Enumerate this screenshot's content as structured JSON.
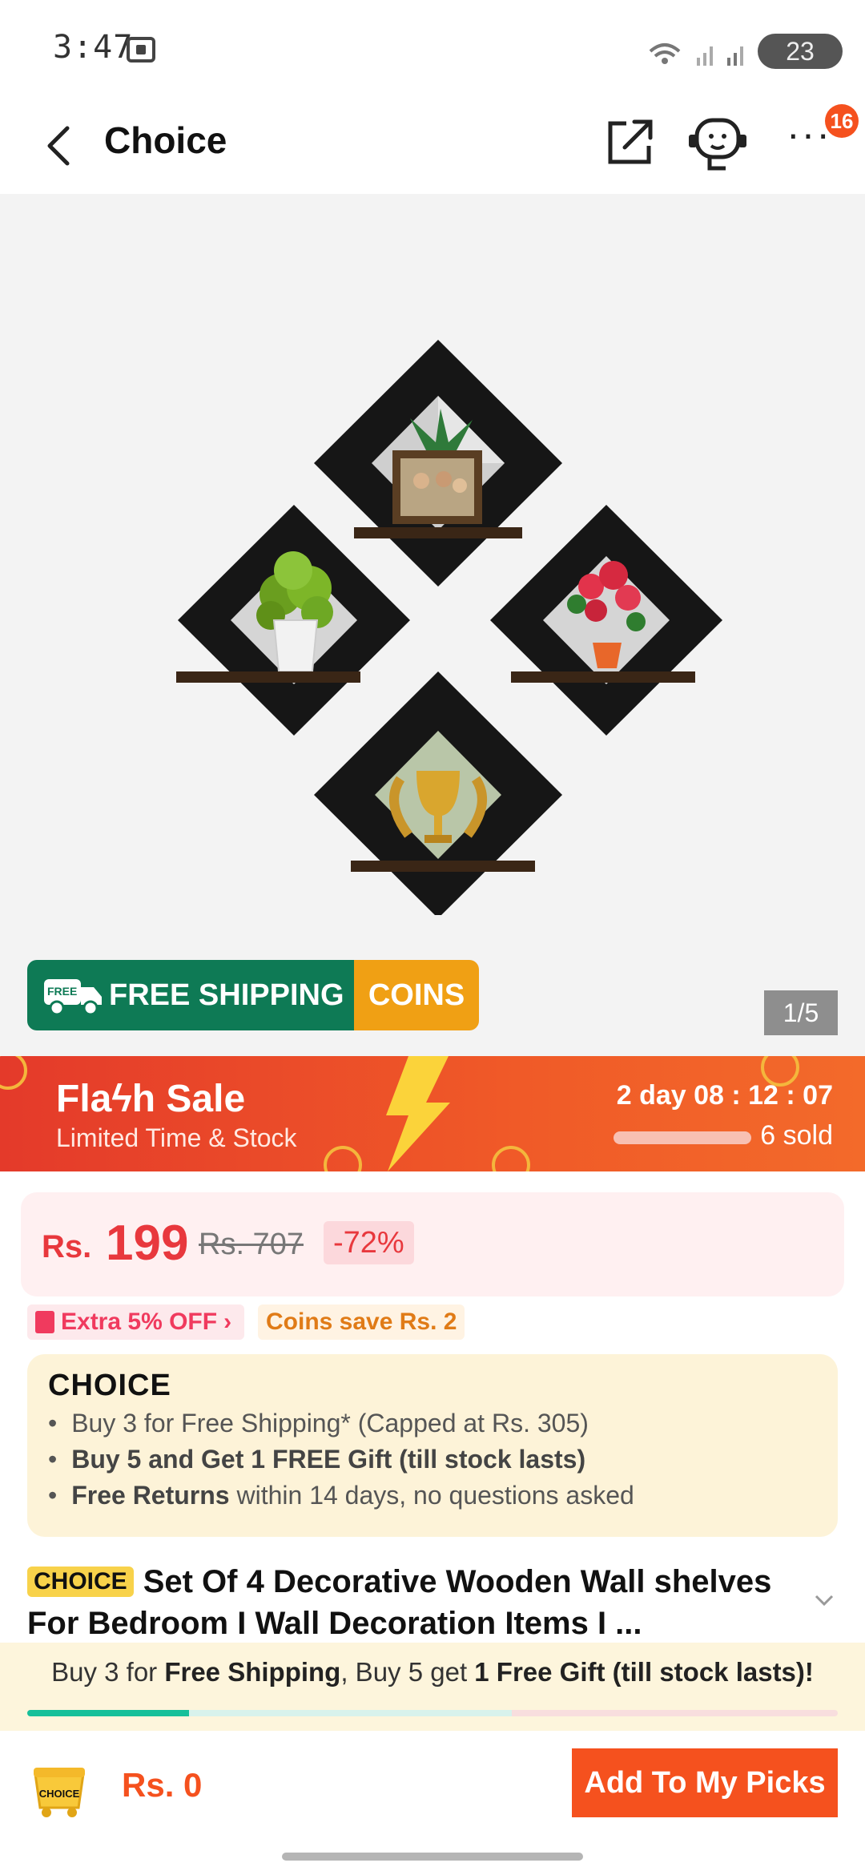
{
  "status_bar": {
    "time": "3:47",
    "battery": "23"
  },
  "header": {
    "title": "Choice",
    "cart_badge": "16"
  },
  "gallery": {
    "free_shipping_label": "FREE SHIPPING",
    "free_tag": "FREE",
    "coins_label": "COINS",
    "page_indicator": "1/5"
  },
  "flash_sale": {
    "title": "Flaϟh Sale",
    "subtitle": "Limited Time & Stock",
    "countdown": "2 day 08 : 12 : 07",
    "sold": "6 sold",
    "sold_progress_pct": 100
  },
  "price": {
    "currency": "Rs.",
    "amount": "199",
    "original": "Rs. 707",
    "discount": "-72%"
  },
  "promos": {
    "extra_off": "Extra 5% OFF",
    "coins_save": "Coins save Rs. 2"
  },
  "choice_box": {
    "logo": "CHOICE",
    "benefits": [
      {
        "bold": "",
        "text": "Buy 3 for  Free Shipping* (Capped at Rs. 305)"
      },
      {
        "bold": "Buy 5 and Get 1 FREE Gift (till stock lasts)",
        "text": ""
      },
      {
        "bold": "Free Returns",
        "text": " within 14 days, no questions asked"
      }
    ]
  },
  "product": {
    "choice_tag": "CHOICE",
    "title": "Set Of 4 Decorative Wooden Wall shelves For Bedroom I Wall Decoration Items I ..."
  },
  "bundle_banner": {
    "part1": "Buy 3 for ",
    "part2": "Free Shipping",
    "part3": ", Buy 5 get ",
    "part4": "1 Free Gift (till stock lasts)!",
    "progress_pct": 20
  },
  "bottom_bar": {
    "cart_label": "CHOICE",
    "total": "Rs. 0",
    "add_button": "Add To My Picks"
  },
  "colors": {
    "accent": "#f5511e",
    "price_red": "#e8383d",
    "free_shipping_green": "#0e7a55",
    "coins_orange": "#f0a014",
    "choice_bg": "#fdf3d8"
  }
}
